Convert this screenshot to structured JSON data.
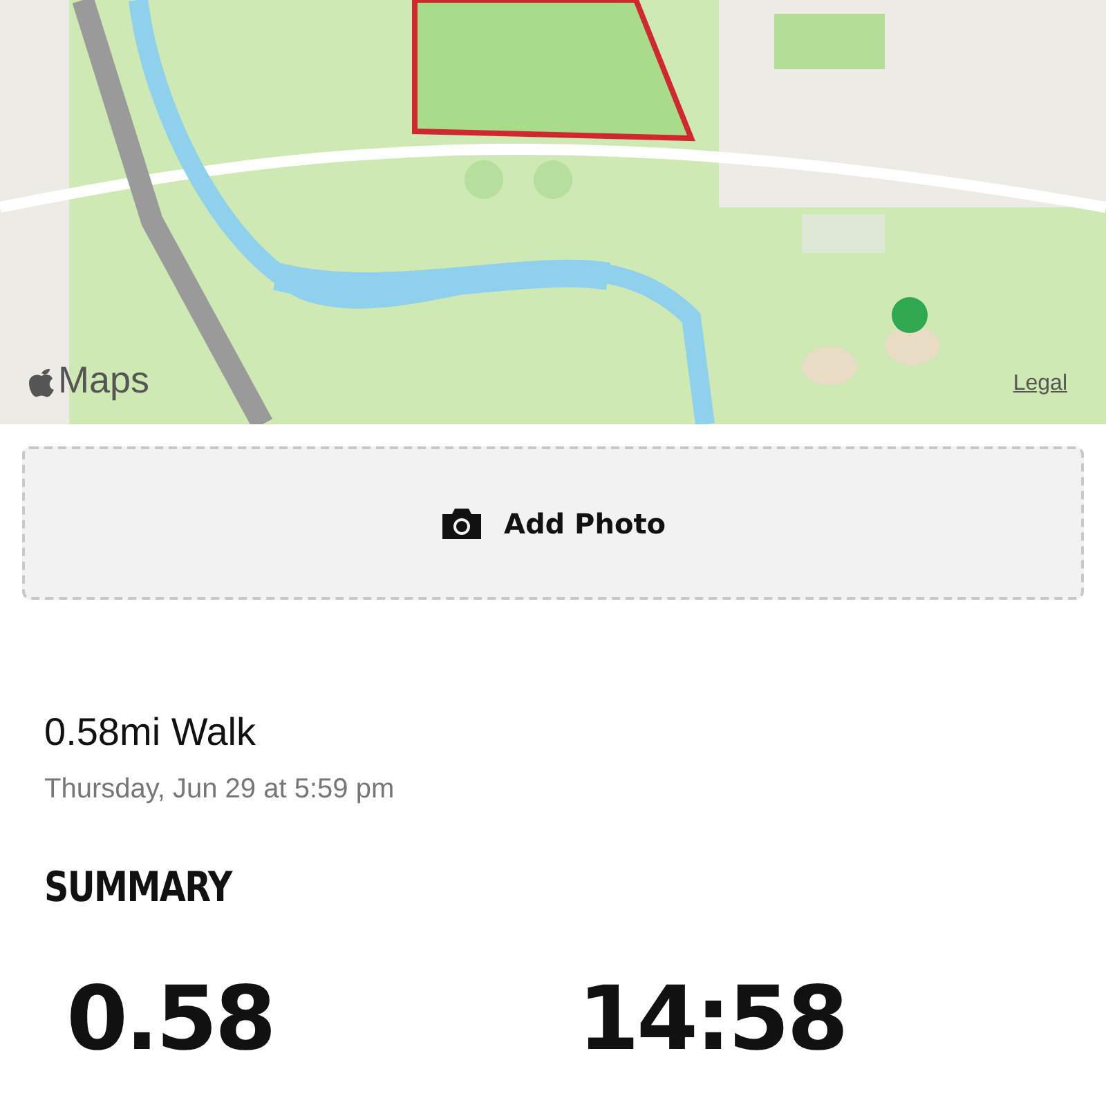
{
  "map": {
    "kind": "picture",
    "attribution": "Maps",
    "legal_link": "Legal"
  },
  "add_photo": {
    "label": "Add Photo"
  },
  "activity": {
    "title": "0.58mi Walk",
    "date": "Thursday, Jun 29 at 5:59 pm"
  },
  "summary": {
    "heading": "SUMMARY",
    "stats": [
      {
        "value": "0.58"
      },
      {
        "value": "14:58"
      }
    ]
  }
}
